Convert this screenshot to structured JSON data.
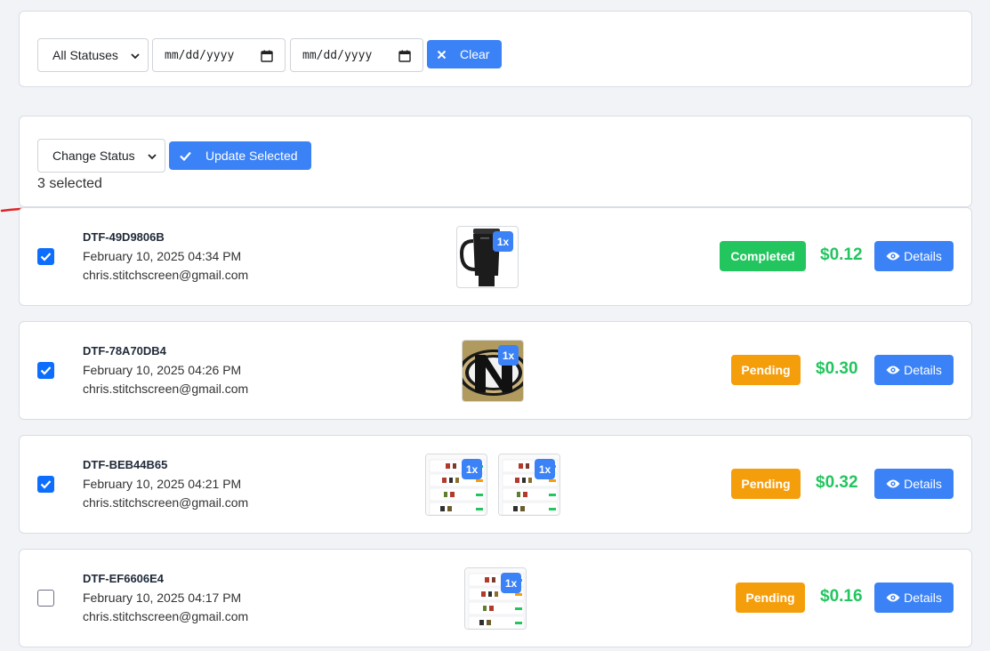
{
  "filters": {
    "status_select": "All Statuses",
    "start_date_placeholder": "mm/dd/yyyy",
    "end_date_placeholder": "mm/dd/yyyy",
    "clear_label": "Clear"
  },
  "bulk": {
    "status_select": "Change Status",
    "update_label": "Update Selected",
    "selected_text": "3 selected"
  },
  "orders": [
    {
      "id": "DTF-49D9806B",
      "date": "February 10, 2025 04:34 PM",
      "email": "chris.stitchscreen@gmail.com",
      "checked": true,
      "thumbnails": [
        {
          "icon": "tumbler-image",
          "qty": "1x"
        }
      ],
      "status": "Completed",
      "price": "$0.12",
      "details_label": "Details"
    },
    {
      "id": "DTF-78A70DB4",
      "date": "February 10, 2025 04:26 PM",
      "email": "chris.stitchscreen@gmail.com",
      "checked": true,
      "thumbnails": [
        {
          "icon": "n-logo-image",
          "qty": "1x"
        }
      ],
      "status": "Pending",
      "price": "$0.30",
      "details_label": "Details"
    },
    {
      "id": "DTF-BEB44B65",
      "date": "February 10, 2025 04:21 PM",
      "email": "chris.stitchscreen@gmail.com",
      "checked": true,
      "thumbnails": [
        {
          "icon": "screenshot-image",
          "qty": "1x"
        },
        {
          "icon": "screenshot-image",
          "qty": "1x"
        }
      ],
      "status": "Pending",
      "price": "$0.32",
      "details_label": "Details"
    },
    {
      "id": "DTF-EF6606E4",
      "date": "February 10, 2025 04:17 PM",
      "email": "chris.stitchscreen@gmail.com",
      "checked": false,
      "thumbnails": [
        {
          "icon": "screenshot-image",
          "qty": "1x"
        }
      ],
      "status": "Pending",
      "price": "$0.16",
      "details_label": "Details"
    }
  ],
  "colors": {
    "primary": "#3b82f6",
    "completed": "#22c55e",
    "pending": "#f59e0b",
    "price": "#22c55e",
    "annotation": "#e02424"
  }
}
